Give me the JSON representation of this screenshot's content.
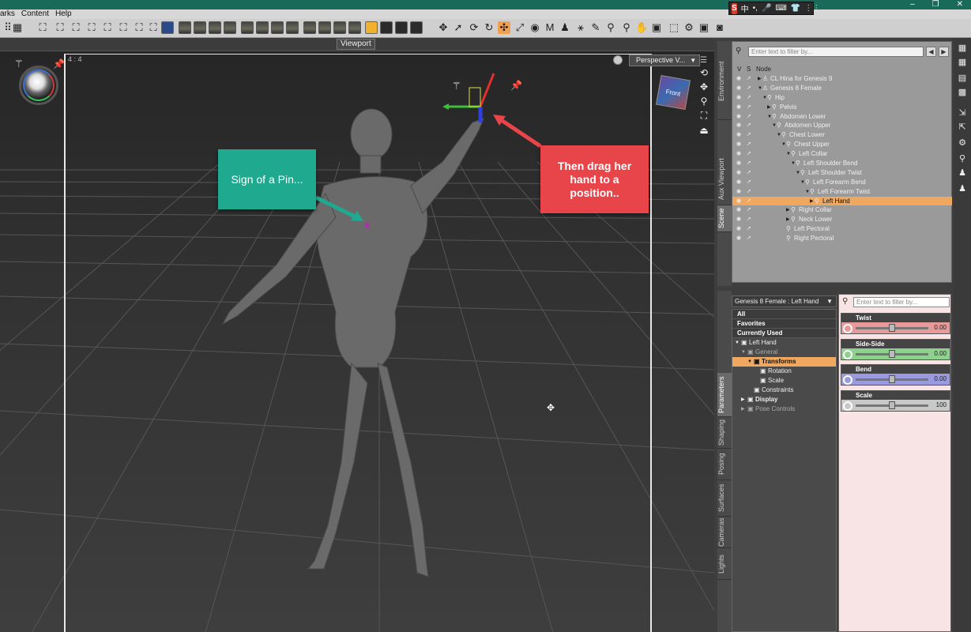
{
  "window": {
    "controls": [
      "–",
      "❐",
      "✕"
    ]
  },
  "ime": {
    "logo": "S",
    "lang": "中",
    "icons": [
      "•,",
      "🎤",
      "⌨",
      "👕",
      "⋮⋮"
    ]
  },
  "menu": [
    "arks",
    "Content",
    "Help"
  ],
  "viewport": {
    "tab": "Viewport",
    "ratio": "4 : 4",
    "camera": "Perspective V...",
    "navcube_label": "Front"
  },
  "callouts": {
    "pin": "Sign of a Pin...",
    "drag": "Then drag her hand to a position.."
  },
  "scene": {
    "filter_placeholder": "Enter text to filter by...",
    "headers": {
      "v": "V",
      "s": "S",
      "node": "Node"
    },
    "side_tabs": [
      "Environment",
      "Aux Viewport",
      "Scene"
    ],
    "nodes": [
      {
        "label": "CL Hina for Genesis 9",
        "depth": 0,
        "expander": "▶",
        "selected": false
      },
      {
        "label": "Genesis 8 Female",
        "depth": 0,
        "expander": "▼",
        "selected": false
      },
      {
        "label": "Hip",
        "depth": 1,
        "expander": "▼",
        "selected": false
      },
      {
        "label": "Pelvis",
        "depth": 2,
        "expander": "▶",
        "selected": false
      },
      {
        "label": "Abdomen Lower",
        "depth": 2,
        "expander": "▼",
        "selected": false
      },
      {
        "label": "Abdomen Upper",
        "depth": 3,
        "expander": "▼",
        "selected": false
      },
      {
        "label": "Chest Lower",
        "depth": 4,
        "expander": "▼",
        "selected": false
      },
      {
        "label": "Chest Upper",
        "depth": 5,
        "expander": "▼",
        "selected": false
      },
      {
        "label": "Left Collar",
        "depth": 6,
        "expander": "▼",
        "selected": false
      },
      {
        "label": "Left Shoulder Bend",
        "depth": 7,
        "expander": "▼",
        "selected": false
      },
      {
        "label": "Left Shoulder Twist",
        "depth": 8,
        "expander": "▼",
        "selected": false
      },
      {
        "label": "Left Forearm Bend",
        "depth": 9,
        "expander": "▼",
        "selected": false
      },
      {
        "label": "Left Forearm Twist",
        "depth": 10,
        "expander": "▼",
        "selected": false
      },
      {
        "label": "Left Hand",
        "depth": 11,
        "expander": "▶",
        "selected": true
      },
      {
        "label": "Right Collar",
        "depth": 6,
        "expander": "▶",
        "selected": false
      },
      {
        "label": "Neck Lower",
        "depth": 6,
        "expander": "▶",
        "selected": false
      },
      {
        "label": "Left Pectoral",
        "depth": 5,
        "expander": "",
        "selected": false
      },
      {
        "label": "Right Pectoral",
        "depth": 5,
        "expander": "",
        "selected": false
      }
    ]
  },
  "parameters": {
    "header": "Genesis 8 Female : Left Hand",
    "filter_placeholder": "Enter text to filter by...",
    "side_tabs": [
      "Parameters",
      "Shaping",
      "Posing",
      "Surfaces",
      "Cameras",
      "Lights"
    ],
    "tree": [
      {
        "label": "All",
        "kind": "hdr",
        "indent": 0
      },
      {
        "label": "Favorites",
        "kind": "hdr",
        "indent": 0
      },
      {
        "label": "Currently Used",
        "kind": "hdr",
        "indent": 0
      },
      {
        "label": "Left Hand",
        "kind": "node",
        "indent": 0,
        "prefix": "▼"
      },
      {
        "label": "General",
        "kind": "dim",
        "indent": 1,
        "prefix": "▼"
      },
      {
        "label": "Transforms",
        "kind": "sel",
        "indent": 2,
        "prefix": "▼"
      },
      {
        "label": "Rotation",
        "kind": "node",
        "indent": 3,
        "prefix": ""
      },
      {
        "label": "Scale",
        "kind": "node",
        "indent": 3,
        "prefix": ""
      },
      {
        "label": "Constraints",
        "kind": "node",
        "indent": 2,
        "prefix": ""
      },
      {
        "label": "Display",
        "kind": "bold",
        "indent": 1,
        "prefix": "▶"
      },
      {
        "label": "Pose Controls",
        "kind": "dim",
        "indent": 1,
        "prefix": "▶"
      }
    ],
    "sliders": [
      {
        "label": "Twist",
        "value": "0.00",
        "fraction": 0.5,
        "color": "#e89a9a"
      },
      {
        "label": "Side-Side",
        "value": "0.00",
        "fraction": 0.5,
        "color": "#8ed08e"
      },
      {
        "label": "Bend",
        "value": "0.00",
        "fraction": 0.5,
        "color": "#9a9ae0"
      },
      {
        "label": "Scale",
        "value": "100",
        "fraction": 0.5,
        "color": "#c8c8c8"
      }
    ]
  },
  "colors": {
    "callout_pin": "#1fa98f",
    "callout_drag": "#e8454a",
    "selection": "#f0a860"
  }
}
